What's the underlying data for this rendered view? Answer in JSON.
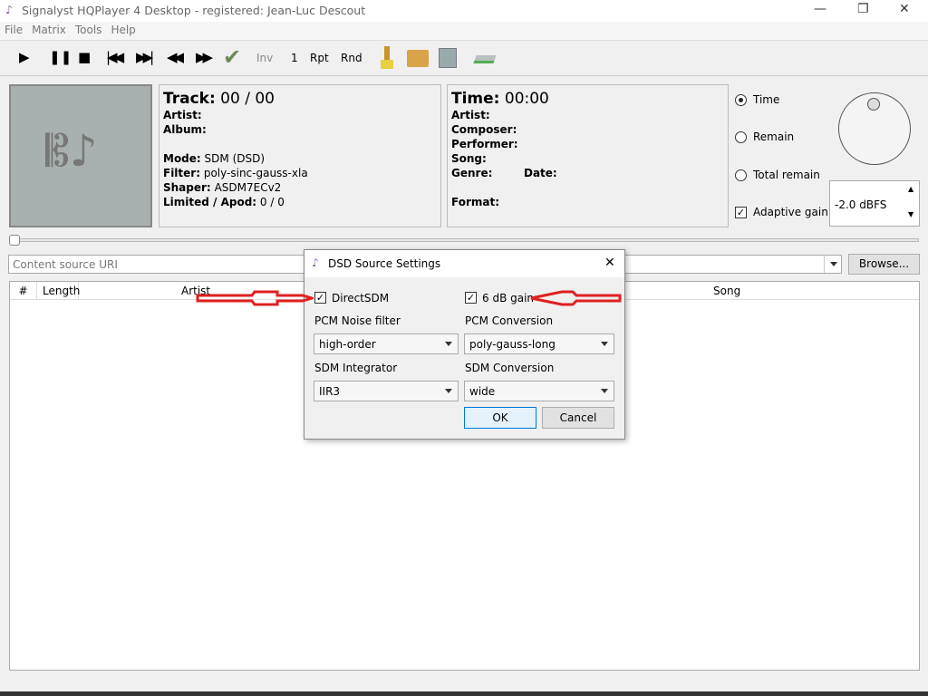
{
  "window": {
    "title": "Signalyst HQPlayer 4 Desktop - registered: Jean-Luc Descout",
    "minimize": "—",
    "maximize": "❐",
    "close": "✕"
  },
  "menu": [
    "File",
    "Matrix",
    "Tools",
    "Help"
  ],
  "toolbar": {
    "inv": "Inv",
    "one": "1",
    "rpt": "Rpt",
    "rnd": "Rnd"
  },
  "track": {
    "title_label": "Track:",
    "title_value": "00 / 00",
    "artist": "Artist:",
    "album": "Album:",
    "mode_label": "Mode:",
    "mode": "SDM (DSD)",
    "filter_label": "Filter:",
    "filter": "poly-sinc-gauss-xla",
    "shaper_label": "Shaper:",
    "shaper": "ASDM7ECv2",
    "limited_label": "Limited / Apod:",
    "limited": "0 / 0"
  },
  "time": {
    "title_label": "Time:",
    "title_value": "00:00",
    "artist": "Artist:",
    "composer": "Composer:",
    "performer": "Performer:",
    "song": "Song:",
    "genre": "Genre:",
    "date": "Date:",
    "format": "Format:"
  },
  "display": {
    "options": [
      "Time",
      "Remain",
      "Total remain"
    ],
    "selected": "Time",
    "adaptive_gain": "Adaptive gain",
    "gain_value": "-2.0 dBFS"
  },
  "source": {
    "placeholder": "Content source URI",
    "browse": "Browse..."
  },
  "table": {
    "columns": [
      "#",
      "Length",
      "Artist",
      "Song"
    ]
  },
  "dialog": {
    "title": "DSD Source Settings",
    "directsdm": "DirectSDM",
    "gain6": "6 dB gain",
    "pcm_noise_label": "PCM Noise filter",
    "pcm_noise": "high-order",
    "pcm_conv_label": "PCM Conversion",
    "pcm_conv": "poly-gauss-long",
    "sdm_int_label": "SDM Integrator",
    "sdm_int": "IIR3",
    "sdm_conv_label": "SDM Conversion",
    "sdm_conv": "wide",
    "ok": "OK",
    "cancel": "Cancel"
  },
  "colors": {
    "annotation_arrow": "#e02020"
  }
}
